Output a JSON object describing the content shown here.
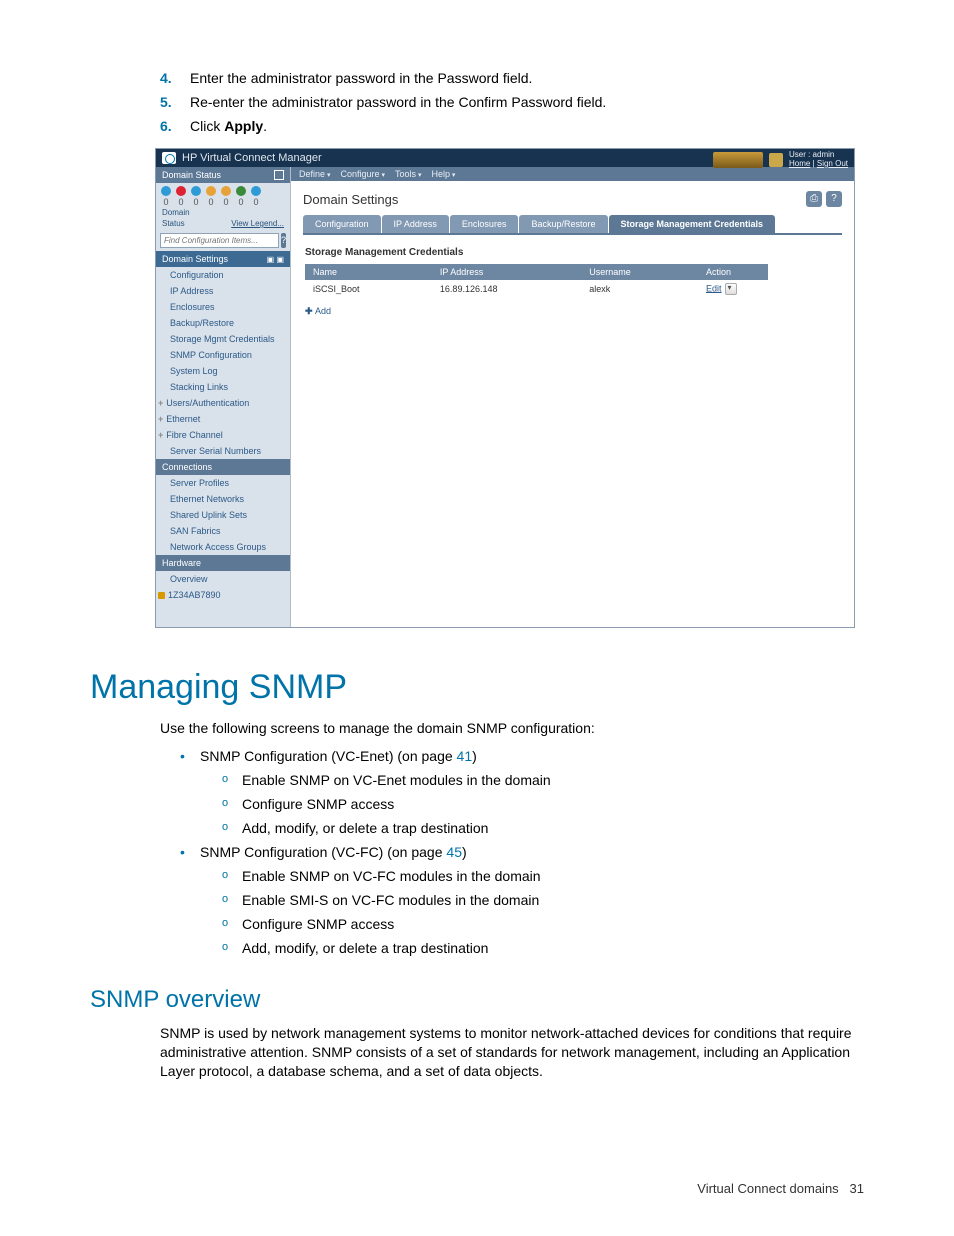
{
  "steps": [
    {
      "num": "4.",
      "text": "Enter the administrator password in the Password field."
    },
    {
      "num": "5.",
      "text": "Re-enter the administrator password in the Confirm Password field."
    },
    {
      "num": "6.",
      "text": "Click ",
      "bold": "Apply",
      "after": "."
    }
  ],
  "app": {
    "title": "HP Virtual Connect Manager",
    "user_label": "User : admin",
    "nav": {
      "home": "Home",
      "signout": "Sign Out"
    },
    "menubar": [
      "Define",
      "Configure",
      "Tools",
      "Help"
    ],
    "sidebar": {
      "status_header": "Domain Status",
      "labels": {
        "domain": "Domain",
        "status": "Status",
        "view_legend": "View Legend..."
      },
      "search_placeholder": "Find Configuration Items...",
      "sections": {
        "domain_settings": "Domain Settings",
        "connections": "Connections",
        "hardware": "Hardware"
      },
      "domain_items": [
        "Configuration",
        "IP Address",
        "Enclosures",
        "Backup/Restore",
        "Storage Mgmt Credentials",
        "SNMP Configuration",
        "System Log",
        "Stacking Links"
      ],
      "domain_tree": [
        "Users/Authentication",
        "Ethernet",
        "Fibre Channel"
      ],
      "domain_tail": [
        "Server Serial Numbers"
      ],
      "connection_items": [
        "Server Profiles",
        "Ethernet Networks",
        "Shared Uplink Sets",
        "SAN Fabrics",
        "Network Access Groups"
      ],
      "hardware_items": [
        "Overview"
      ],
      "hardware_device": "1Z34AB7890"
    },
    "page_title": "Domain Settings",
    "tabs": [
      "Configuration",
      "IP Address",
      "Enclosures",
      "Backup/Restore",
      "Storage Management Credentials"
    ],
    "active_tab": 4,
    "subsection_title": "Storage Management Credentials",
    "table": {
      "headers": [
        "Name",
        "IP Address",
        "Username",
        "Action"
      ],
      "row": {
        "name": "iSCSI_Boot",
        "ip": "16.89.126.148",
        "user": "alexk",
        "action": "Edit"
      }
    },
    "add_label": "Add"
  },
  "sections": {
    "managing_title": "Managing SNMP",
    "managing_intro": "Use the following screens to manage the domain SNMP configuration:",
    "bullets": [
      {
        "label": "SNMP Configuration (VC-Enet) (on page ",
        "page": "41",
        "after": ")",
        "subs": [
          "Enable SNMP on VC-Enet modules in the domain",
          "Configure SNMP access",
          "Add, modify, or delete a trap destination"
        ]
      },
      {
        "label": "SNMP Configuration (VC-FC) (on page ",
        "page": "45",
        "after": ")",
        "subs": [
          "Enable SNMP on VC-FC modules in the domain",
          "Enable SMI-S on VC-FC modules in the domain",
          "Configure SNMP access",
          "Add, modify, or delete a trap destination"
        ]
      }
    ],
    "overview_title": "SNMP overview",
    "overview_text": "SNMP is used by network management systems to monitor network-attached devices for conditions that require administrative attention. SNMP consists of a set of standards for network management, including an Application Layer protocol, a database schema, and a set of data objects."
  },
  "footer": {
    "label": "Virtual Connect domains",
    "page": "31"
  }
}
